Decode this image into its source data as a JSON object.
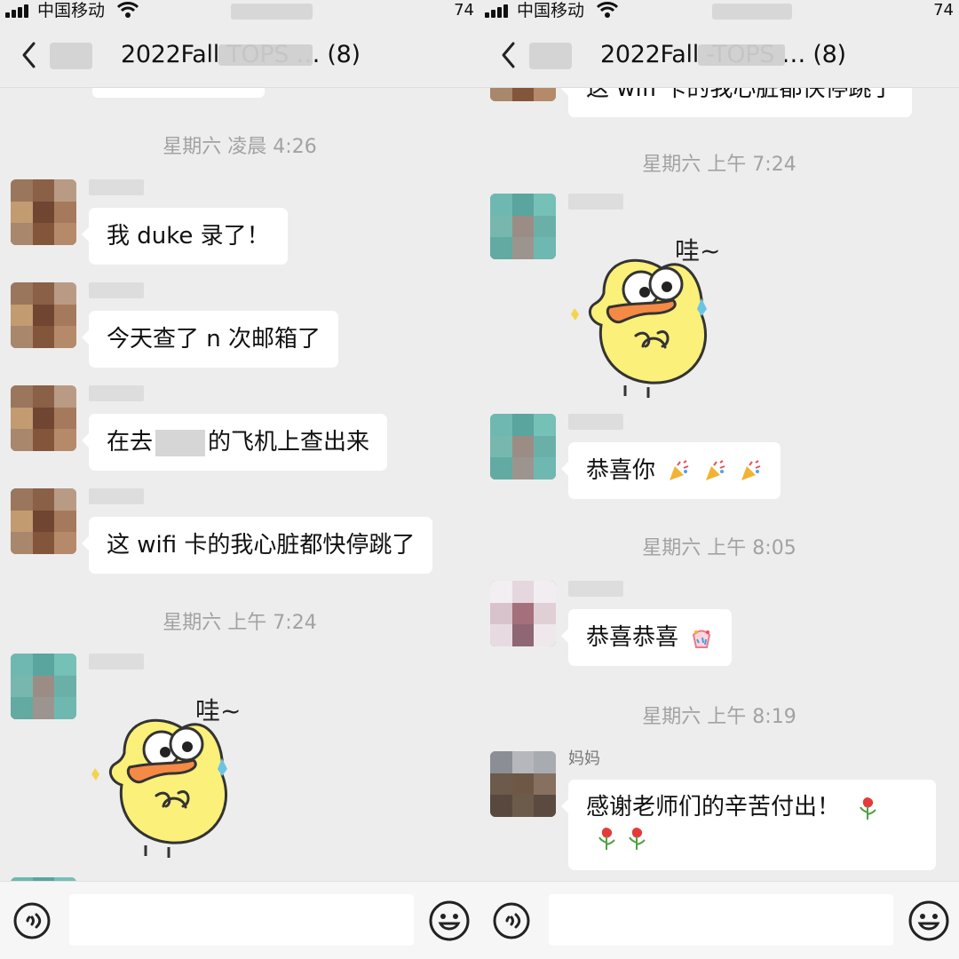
{
  "screens": [
    {
      "status": {
        "carrier": "中国移动",
        "battery": "74"
      },
      "header": {
        "title": "2022Fall          TOPS … (8)"
      },
      "timestamps": [
        "星期六 凌晨 4:26",
        "星期六 上午 7:24"
      ],
      "messages": [
        {
          "text": "我 duke 录了！"
        },
        {
          "text": "今天查了 n 次邮箱了"
        },
        {
          "prefix": "在去",
          "suffix": "的飞机上查出来"
        },
        {
          "text": "这 wifi 卡的我心脏都快停跳了"
        }
      ],
      "sticker": {
        "label": "哇~"
      }
    },
    {
      "status": {
        "carrier": "中国移动",
        "battery": "74"
      },
      "header": {
        "title": "2022Fall          -TOPS … (8)"
      },
      "timestamps": [
        "星期六 上午 7:24",
        "星期六 上午 8:05",
        "星期六 上午 8:19"
      ],
      "partial_top_message": "这 wifi 卡的我心脏都快停跳了",
      "sticker": {
        "label": "哇~"
      },
      "messages": [
        {
          "text": "恭喜你"
        },
        {
          "text": "恭喜恭喜"
        },
        {
          "sender": "妈妈",
          "text": "感谢老师们的辛苦付出！"
        }
      ]
    }
  ],
  "icons": {
    "back": "back-icon",
    "voice": "voice-icon",
    "emoji": "emoji-icon",
    "signal": "signal-icon",
    "wifi": "wifi-icon",
    "party": "party-popper-icon",
    "rose": "rose-icon"
  },
  "colors": {
    "bg": "#ededed",
    "bubble": "#ffffff",
    "time": "#a2a2a2",
    "accent": "#2f2f2f"
  }
}
